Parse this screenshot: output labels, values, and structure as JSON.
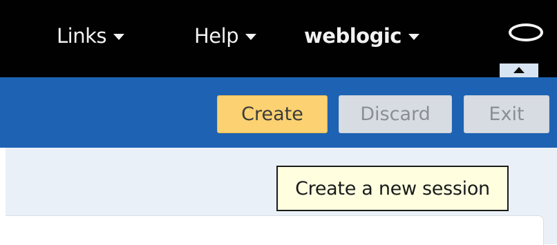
{
  "header": {
    "nav": {
      "links_label": "Links",
      "help_label": "Help",
      "user_label": "weblogic"
    },
    "icons": {
      "status": "oval-icon",
      "collapse": "up-arrow-icon",
      "dropdown": "caret-down-icon"
    }
  },
  "toolbar": {
    "create_label": "Create",
    "discard_label": "Discard",
    "exit_label": "Exit"
  },
  "tooltip": {
    "text": "Create a new session"
  },
  "colors": {
    "header_bg": "#010101",
    "toolbar_bg": "#1d62b3",
    "create_bg": "#fbd171",
    "disabled_bg": "#d7dce3",
    "tooltip_bg": "#ffffe0"
  }
}
